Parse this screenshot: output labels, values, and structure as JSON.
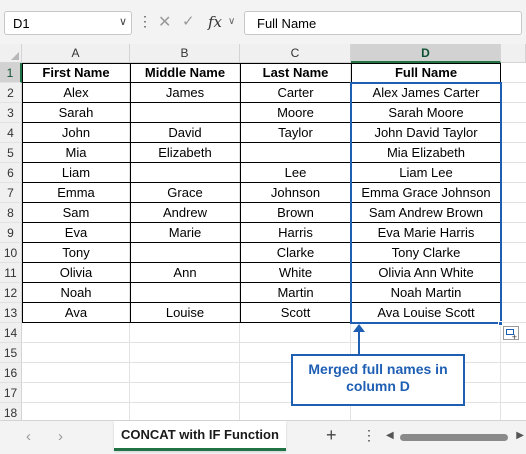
{
  "formula_bar": {
    "name_box": "D1",
    "formula": "Full Name",
    "more_glyph": "⋮",
    "cancel_glyph": "✕",
    "enter_glyph": "✓",
    "fx_label": "fx",
    "fx_dropdown_glyph": "∨",
    "name_box_dropdown_glyph": "∨"
  },
  "grid": {
    "columns": [
      "A",
      "B",
      "C",
      "D"
    ],
    "selected_column": "D",
    "rows": [
      "1",
      "2",
      "3",
      "4",
      "5",
      "6",
      "7",
      "8",
      "9",
      "10",
      "11",
      "12",
      "13",
      "14",
      "15",
      "16",
      "17",
      "18"
    ],
    "selected_row": "1",
    "table": {
      "headers": [
        "First Name",
        "Middle Name",
        "Last Name",
        "Full Name"
      ],
      "data": [
        [
          "Alex",
          "James",
          "Carter",
          "Alex James Carter"
        ],
        [
          "Sarah",
          "",
          "Moore",
          "Sarah Moore"
        ],
        [
          "John",
          "David",
          "Taylor",
          "John David Taylor"
        ],
        [
          "Mia",
          "Elizabeth",
          "",
          "Mia Elizabeth"
        ],
        [
          "Liam",
          "",
          "Lee",
          "Liam Lee"
        ],
        [
          "Emma",
          "Grace",
          "Johnson",
          "Emma Grace Johnson"
        ],
        [
          "Sam",
          "Andrew",
          "Brown",
          "Sam Andrew Brown"
        ],
        [
          "Eva",
          "Marie",
          "Harris",
          "Eva Marie Harris"
        ],
        [
          "Tony",
          "",
          "Clarke",
          "Tony Clarke"
        ],
        [
          "Olivia",
          "Ann",
          "White",
          "Olivia Ann White"
        ],
        [
          "Noah",
          "",
          "Martin",
          "Noah Martin"
        ],
        [
          "Ava",
          "Louise",
          "Scott",
          "Ava Louise Scott"
        ]
      ]
    },
    "callout": {
      "line1": "Merged full names in",
      "line2": "column D",
      "color": "#1e5fb4"
    }
  },
  "sheet_tabs": {
    "prev_glyph": "‹",
    "next_glyph": "›",
    "active_tab": "CONCAT with IF Function",
    "add_glyph": "+",
    "more_glyph": "⋮",
    "scroll_left_glyph": "◀",
    "scroll_right_glyph": "▶"
  },
  "colors": {
    "accent": "#217346",
    "selection": "#1e5fb4"
  }
}
